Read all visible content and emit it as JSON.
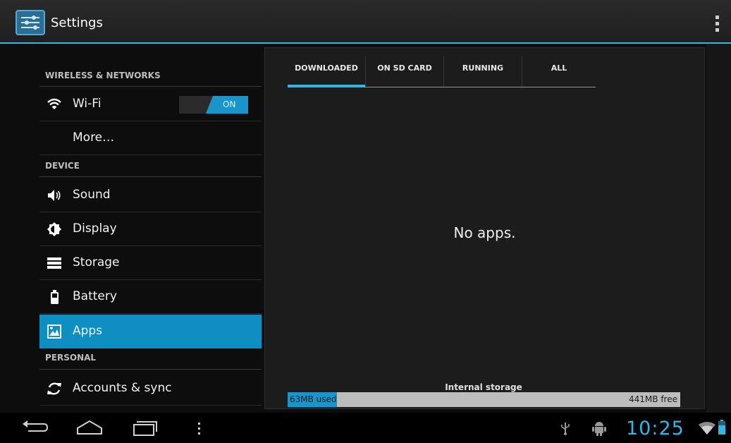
{
  "app": {
    "title": "Settings",
    "icon": "settings-sliders-icon"
  },
  "sidebar": {
    "sections": [
      {
        "header": "WIRELESS & NETWORKS"
      },
      {
        "header": "DEVICE"
      },
      {
        "header": "PERSONAL"
      }
    ],
    "items": [
      {
        "label": "Wi-Fi",
        "icon": "wifi-icon",
        "toggle": "ON"
      },
      {
        "label": "More…",
        "icon": ""
      },
      {
        "label": "Sound",
        "icon": "speaker-icon"
      },
      {
        "label": "Display",
        "icon": "brightness-icon"
      },
      {
        "label": "Storage",
        "icon": "storage-icon"
      },
      {
        "label": "Battery",
        "icon": "battery-icon"
      },
      {
        "label": "Apps",
        "icon": "apps-icon",
        "selected": true
      },
      {
        "label": "Accounts & sync",
        "icon": "sync-icon"
      }
    ]
  },
  "main": {
    "tabs": [
      {
        "label": "DOWNLOADED",
        "selected": true
      },
      {
        "label": "ON SD CARD"
      },
      {
        "label": "RUNNING"
      },
      {
        "label": "ALL"
      }
    ],
    "empty_message": "No apps.",
    "storage": {
      "label": "Internal storage",
      "used": "63MB used",
      "free": "441MB free",
      "used_fraction": 0.125
    }
  },
  "system_bar": {
    "clock": "10:25"
  },
  "colors": {
    "accent": "#33b5e5",
    "selected": "#0f8fc1",
    "toggle_on": "#1a94c9"
  }
}
